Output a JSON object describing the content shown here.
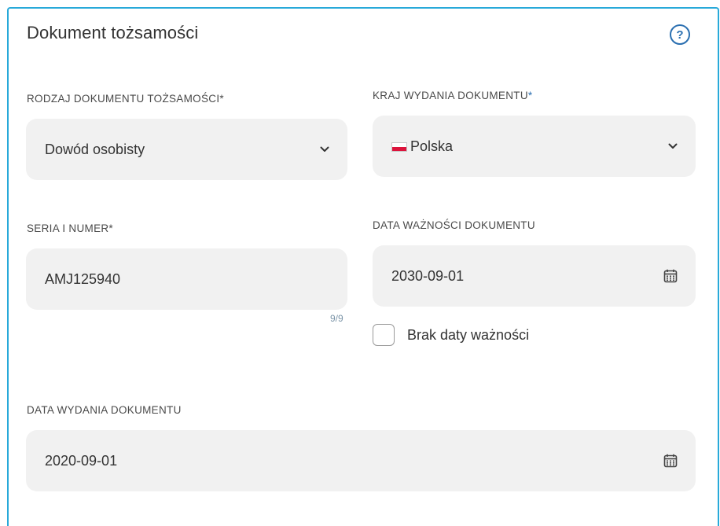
{
  "section": {
    "title": "Dokument tożsamości",
    "help_icon": "question-circle-icon",
    "help_glyph": "?"
  },
  "doc_type": {
    "label": "RODZAJ DOKUMENTU TOŻSAMOŚCI",
    "required_mark": "*",
    "value": "Dowód osobisty",
    "icon": "chevron-down-icon"
  },
  "country": {
    "label": "KRAJ WYDANIA DOKUMENTU",
    "required_mark": "*",
    "value": "Polska",
    "flag_icon": "poland-flag-icon",
    "icon": "chevron-down-icon",
    "required_mark_color": "#2a6fb0"
  },
  "series_number": {
    "label": "SERIA I NUMER",
    "required_mark": "*",
    "value": "AMJ125940",
    "counter": "9/9"
  },
  "expiry_date": {
    "label": "DATA WAŻNOŚCI DOKUMENTU",
    "value": "2030-09-01",
    "icon": "calendar-icon"
  },
  "no_expiry": {
    "label": "Brak daty ważności",
    "checked": false
  },
  "issue_date": {
    "label": "DATA WYDANIA DOKUMENTU",
    "value": "2020-09-01",
    "icon": "calendar-icon"
  },
  "colors": {
    "accent_border": "#28a9d9",
    "accent": "#2a6fb0",
    "field_bg": "#f1f1f1"
  }
}
